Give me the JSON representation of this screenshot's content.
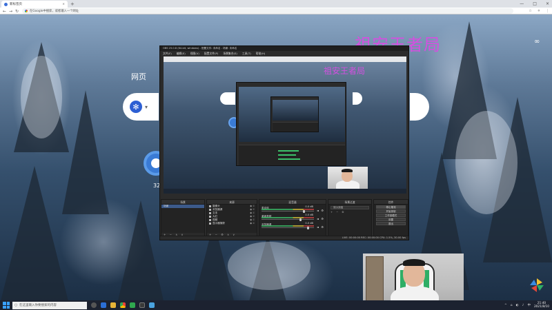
{
  "browser": {
    "tab_title": "新标签页",
    "tab_close": "×",
    "new_tab": "+",
    "window_controls": [
      "—",
      "□",
      "×"
    ],
    "omnibox_text": "在Google中搜索，或者输入一个网址",
    "right_icons": [
      "☆",
      "⚪",
      "⋮"
    ]
  },
  "page": {
    "overlay_title": "祖安王者局",
    "infinity_icon": "∞",
    "web_label": "网页",
    "search_caret": "▾",
    "count_label": "32"
  },
  "obs": {
    "title": "OBS 25.0.8 (64-bit, windows) - 配置文件: 未命名 - 场景: 未命名",
    "menu": [
      "文件(F)",
      "编辑(E)",
      "视图(V)",
      "配置文件(P)",
      "场景集合(S)",
      "工具(T)",
      "帮助(H)"
    ],
    "preview_title": "祖安王者局",
    "docks": {
      "scenes": {
        "header": "场景",
        "items": [
          "场景"
        ],
        "footer": "+ − ∧ ∨"
      },
      "sources": {
        "header": "来源",
        "items": [
          "摄像头",
          "浏览器源",
          "文本",
          "大红",
          "视频",
          "显示器捕获"
        ],
        "footer": "+ − ⚙ ∧ ∨"
      },
      "mixer": {
        "header": "混音器",
        "channels": [
          {
            "name": "麦克风",
            "db": "0.0 dB",
            "level": 0.82
          },
          {
            "name": "桌面音频",
            "db": "0.0 dB",
            "level": 0.76
          },
          {
            "name": "浏览器源",
            "db": "0.0 dB",
            "level": 0.9
          }
        ]
      },
      "transitions": {
        "header": "场景过渡",
        "type": "淡入淡出",
        "footer": "+ − ⚙"
      },
      "controls": {
        "header": "控件",
        "buttons": [
          "停止推流",
          "开始录制",
          "工作室模式",
          "设置",
          "退出"
        ]
      }
    },
    "status": "LIVE: 00:00:00    REC: 00:00:00    CPU: 1.5%, 30.00 fps"
  },
  "taskbar": {
    "search_placeholder": "在这里输入你要搜索的内容",
    "tray_icons": [
      "^",
      "⌂",
      "◐",
      "♪",
      "中"
    ],
    "time": "21:40",
    "date": "2021/8/10"
  }
}
